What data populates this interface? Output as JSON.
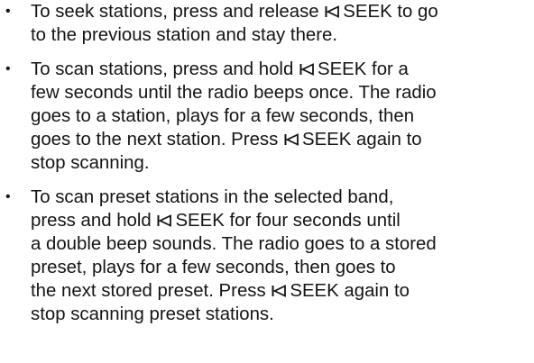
{
  "icons": {
    "bullet": "bullet-dot-icon",
    "seek_back": "seek-back-icon"
  },
  "seek_label": "SEEK",
  "items": [
    {
      "lines": [
        [
          "To seek stations, press and release ",
          "seek",
          " to go"
        ],
        [
          "to the previous station and stay there."
        ]
      ]
    },
    {
      "lines": [
        [
          "To scan stations, press and hold ",
          "seek",
          " for a"
        ],
        [
          "few seconds until the radio beeps once. The radio"
        ],
        [
          "goes to a station, plays for a few seconds, then"
        ],
        [
          "goes to the next station. Press ",
          "seek",
          " again to"
        ],
        [
          "stop scanning."
        ]
      ]
    },
    {
      "lines": [
        [
          "To scan preset stations in the selected band,"
        ],
        [
          "press and hold ",
          "seek",
          " for four seconds until"
        ],
        [
          "a double beep sounds. The radio goes to a stored"
        ],
        [
          "preset, plays for a few seconds, then goes to"
        ],
        [
          "the next stored preset. Press ",
          "seek",
          " again to"
        ],
        [
          "stop scanning preset stations."
        ]
      ]
    }
  ]
}
